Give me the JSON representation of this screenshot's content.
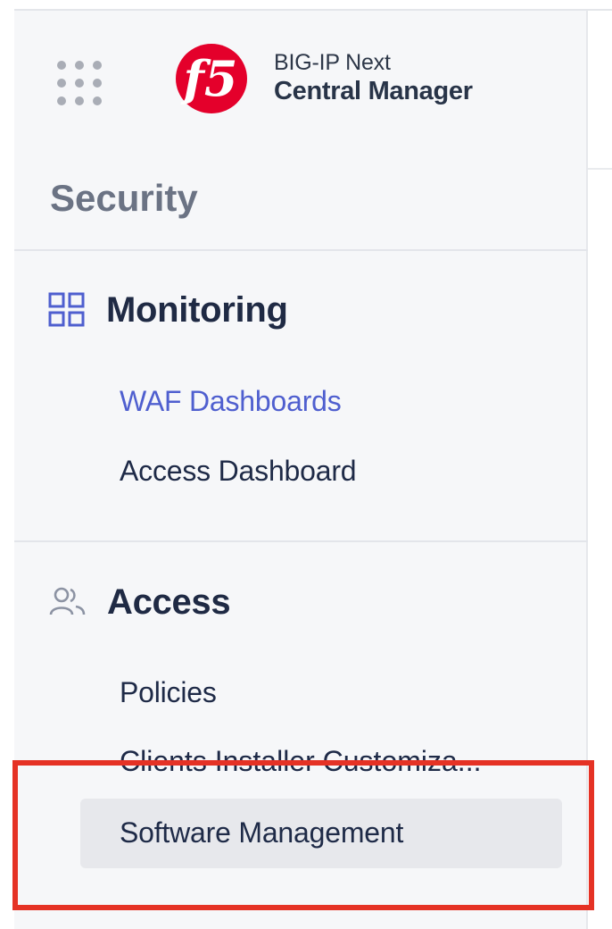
{
  "header": {
    "product_line": "BIG-IP Next",
    "product_name": "Central Manager",
    "icons": {
      "app_switcher": "grid-dots-icon",
      "logo": "f5-logo"
    },
    "brand_color": "#e4002b"
  },
  "sidebar": {
    "section_title": "Security",
    "groups": [
      {
        "title": "Monitoring",
        "icon": "dashboard-grid-icon",
        "items": [
          {
            "label": "WAF Dashboards",
            "active": true
          },
          {
            "label": "Access Dashboard",
            "active": false
          }
        ]
      },
      {
        "title": "Access",
        "icon": "users-icon",
        "items": [
          {
            "label": "Policies",
            "active": false
          },
          {
            "label": "Clients Installer Customiza...",
            "active": false
          },
          {
            "label": "Software Management",
            "active": false,
            "highlighted": true
          }
        ]
      }
    ]
  },
  "colors": {
    "active_link": "#4f5fcf",
    "text_primary": "#1e2a47",
    "highlight_outline": "#e53225"
  }
}
